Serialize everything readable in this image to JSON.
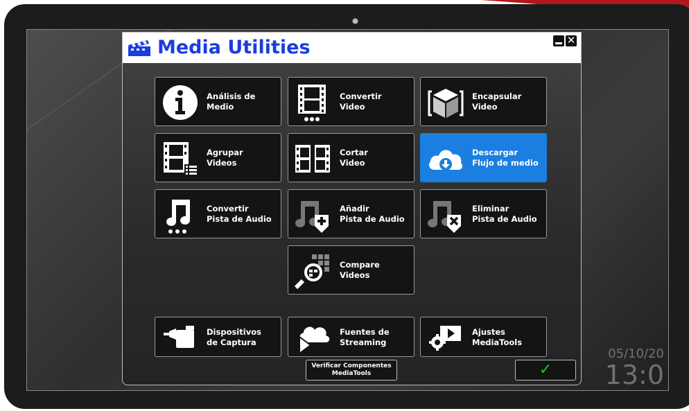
{
  "app": {
    "title": "Media Utilities"
  },
  "window_controls": {
    "minimize": "minimize",
    "close": "✕"
  },
  "tiles": [
    {
      "id": "analisis",
      "line1": "Análisis de",
      "line2": "Medio",
      "icon": "info-icon"
    },
    {
      "id": "convertir-video",
      "line1": "Convertir",
      "line2": "Video",
      "icon": "film-icon"
    },
    {
      "id": "encapsular",
      "line1": "Encapsular",
      "line2": "Video",
      "icon": "cube-icon"
    },
    {
      "id": "agrupar",
      "line1": "Agrupar",
      "line2": "Videos",
      "icon": "film-list-icon"
    },
    {
      "id": "cortar",
      "line1": "Cortar",
      "line2": "Video",
      "icon": "film-cut-icon"
    },
    {
      "id": "descargar",
      "line1": "Descargar",
      "line2": "Flujo de medio",
      "icon": "cloud-download-icon",
      "selected": true
    },
    {
      "id": "convertir-audio",
      "line1": "Convertir",
      "line2": "Pista de Audio",
      "icon": "music-note-icon"
    },
    {
      "id": "anadir-audio",
      "line1": "Añadir",
      "line2": "Pista de Audio",
      "icon": "music-add-icon"
    },
    {
      "id": "eliminar-audio",
      "line1": "Eliminar",
      "line2": "Pista de Audio",
      "icon": "music-remove-icon"
    },
    {
      "id": "compare",
      "line1": "Compare",
      "line2": "Videos",
      "icon": "compare-search-icon"
    },
    {
      "id": "dispositivos",
      "line1": "Dispositivos",
      "line2": "de Captura",
      "icon": "camera-icon"
    },
    {
      "id": "fuentes",
      "line1": "Fuentes de",
      "line2": "Streaming",
      "icon": "cloud-play-icon"
    },
    {
      "id": "ajustes",
      "line1": "Ajustes",
      "line2": "MediaTools",
      "icon": "settings-play-icon"
    }
  ],
  "footer": {
    "verify_line1": "Verificar Componentes",
    "verify_line2": "MediaTools",
    "ok": "✓"
  },
  "clock": {
    "date": "05/10/20",
    "time": "13:0"
  },
  "colors": {
    "title": "#1a3de0",
    "selected": "#1a7fe0",
    "ok": "#23c223"
  }
}
